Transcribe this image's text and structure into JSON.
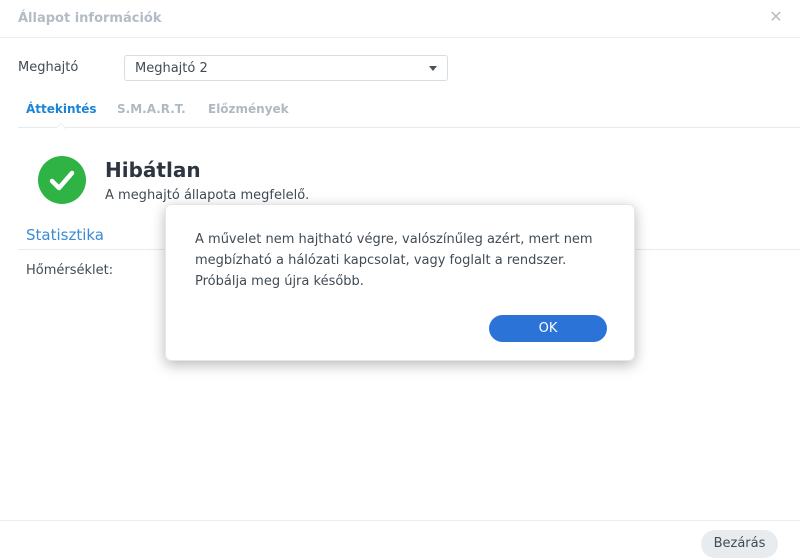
{
  "window": {
    "title": "Állapot információk",
    "close_icon": "close-icon"
  },
  "drive": {
    "label": "Meghajtó",
    "selected": "Meghajtó 2"
  },
  "tabs": [
    {
      "label": "Áttekintés",
      "active": true
    },
    {
      "label": "S.M.A.R.T.",
      "active": false
    },
    {
      "label": "Előzmények",
      "active": false
    }
  ],
  "overview": {
    "status_icon": "check-circle-icon",
    "status_color": "#2fb344",
    "status_title": "Hibátlan",
    "status_description": "A meghajtó állapota megfelelő.",
    "section_title": "Statisztika",
    "temperature_label": "Hőmérséklet:"
  },
  "footer": {
    "close_label": "Bezárás"
  },
  "dialog": {
    "message_lines": [
      "A művelet nem hajtható végre, valószínűleg azért, mert nem",
      "megbízható a hálózati kapcsolat, vagy foglalt a rendszer.",
      "Próbálja meg újra később."
    ],
    "ok_label": "OK",
    "ok_color": "#2b73d6"
  }
}
